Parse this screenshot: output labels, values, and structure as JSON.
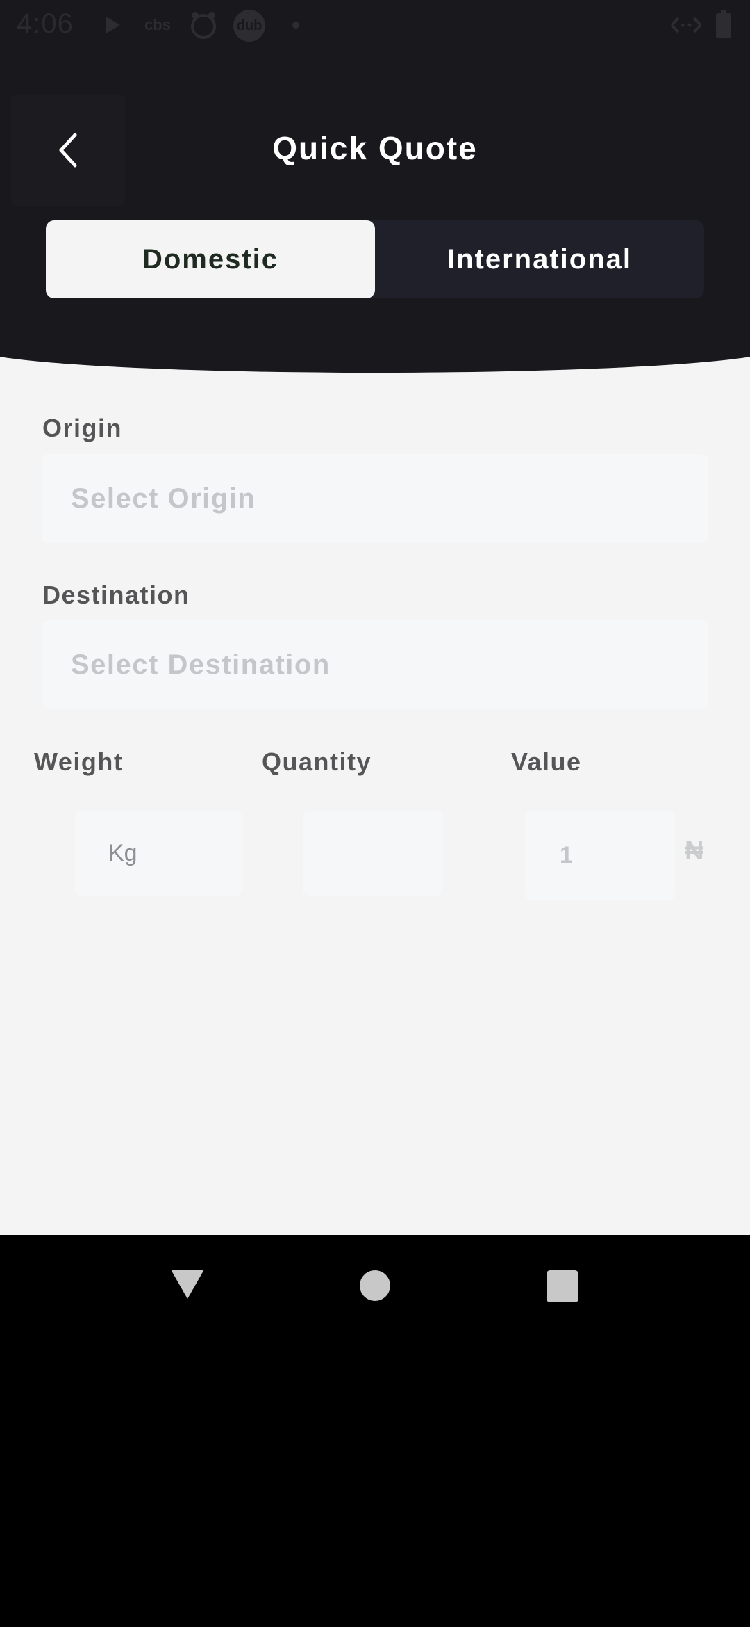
{
  "status_bar": {
    "time": "4:06",
    "icons": [
      "play-icon",
      "cbs-icon",
      "animal-icon",
      "dub-icon",
      "dot-icon",
      "signal-icon",
      "battery-icon"
    ],
    "cbs_text": "cbs",
    "dub_text": "dub"
  },
  "header": {
    "title": "Quick Quote",
    "back_icon": "chevron-left-icon"
  },
  "tabs": [
    {
      "label": "Domestic",
      "active": true
    },
    {
      "label": "International",
      "active": false
    }
  ],
  "form": {
    "origin": {
      "label": "Origin",
      "placeholder": "Select Origin"
    },
    "destination": {
      "label": "Destination",
      "placeholder": "Select Destination"
    },
    "weight": {
      "label": "Weight",
      "placeholder": "Kg"
    },
    "quantity": {
      "label": "Quantity",
      "value": ""
    },
    "value": {
      "label": "Value",
      "placeholder": "1",
      "currency": "₦"
    }
  },
  "navigation": {
    "back_icon": "triangle-back-icon",
    "home_icon": "circle-home-icon",
    "recents_icon": "square-recents-icon"
  },
  "colors": {
    "header_bg": "#18181d",
    "tab_active_bg": "#f4f4f4",
    "tab_inactive_bg": "#1f2029",
    "page_bg": "#f4f4f4",
    "field_bg": "#f6f7f9"
  }
}
